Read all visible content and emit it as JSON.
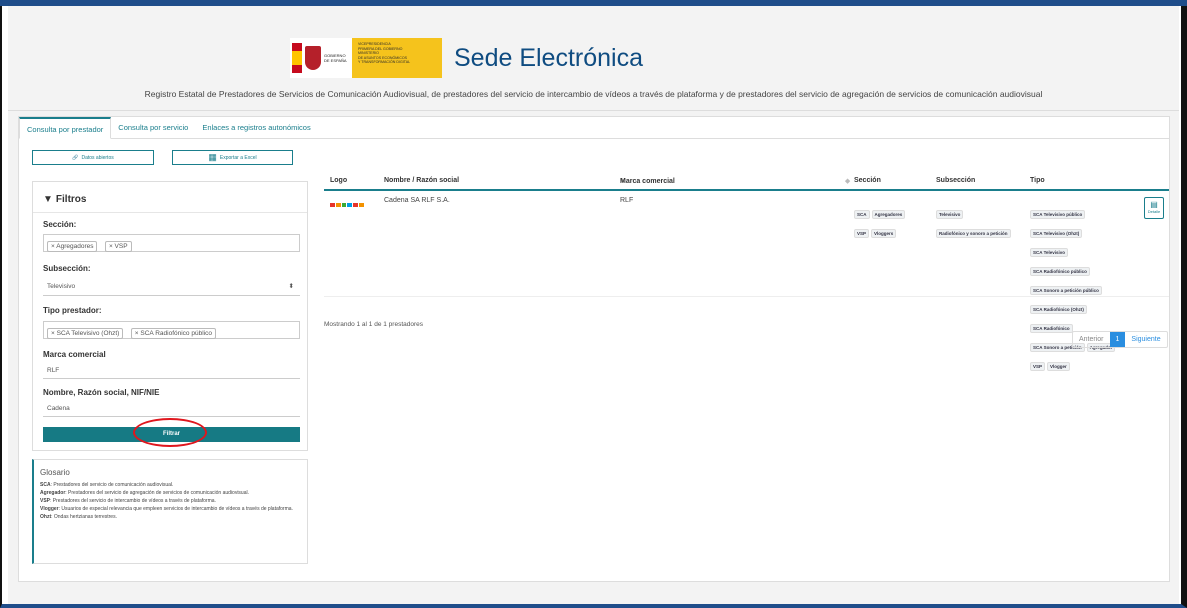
{
  "header": {
    "gov_line1": "GOBIERNO",
    "gov_line2": "DE ESPAÑA",
    "ministry_lines": [
      "VICEPRESIDENCIA",
      "PRIMERA DEL GOBIERNO",
      "MINISTERIO",
      "DE ASUNTOS ECONÓMICOS",
      "Y TRANSFORMACIÓN DIGITAL"
    ],
    "site_title": "Sede Electrónica",
    "subtitle": "Registro Estatal de Prestadores de Servicios de Comunicación Audiovisual, de prestadores del servicio de intercambio de vídeos a través de plataforma y de prestadores del servicio de agregación de servicios de comunicación audiovisual"
  },
  "tabs": [
    {
      "label": "Consulta por prestador"
    },
    {
      "label": "Consulta por servicio"
    },
    {
      "label": "Enlaces a registros autonómicos"
    }
  ],
  "actions": {
    "direct_data": "Datos abiertos",
    "export_excel": "Exportar a Excel"
  },
  "filters": {
    "title": "Filtros",
    "section_label": "Sección:",
    "section_tags": [
      "Agregadores",
      "VSP"
    ],
    "subsection_label": "Subsección:",
    "subsection_value": "Televisivo",
    "type_label": "Tipo prestador:",
    "type_tags": [
      "SCA Televisivo (Ohzt)",
      "SCA Radiofónico público"
    ],
    "brand_label": "Marca comercial",
    "brand_value": "RLF",
    "name_label": "Nombre, Razón social, NIF/NIE",
    "name_value": "Cadena",
    "filter_button": "Filtrar"
  },
  "glossary": {
    "title": "Glosario",
    "items": [
      {
        "term": "SCA",
        "text": ": Prestadores del servicio de comunicación audiovisual."
      },
      {
        "term": "Agregador",
        "text": ": Prestadores del servicio de agregación de servicios de comunicación audiovisual."
      },
      {
        "term": "VSP",
        "text": ": Prestadores del servicio de intercambio de vídeos a través de plataforma."
      },
      {
        "term": "Vlogger",
        "text": ": Usuarios de especial relevancia que empleen servicios de intercambio de vídeos a través de plataforma."
      },
      {
        "term": "Ohzt",
        "text": ": Ondas hertzianas terrestres."
      }
    ]
  },
  "table": {
    "headers": [
      "Logo",
      "Nombre / Razón social",
      "Marca comercial",
      "Sección",
      "Subsección",
      "Tipo"
    ],
    "row": {
      "name": "Cadena SA RLF S.A.",
      "brand": "RLF",
      "sections": [
        "SCA",
        "Agregadores",
        "VSP",
        "Vloggers"
      ],
      "subsections": [
        "Televisivo",
        "Radiofónico y sonoro a petición"
      ],
      "types": [
        "SCA Televisivo público",
        "SCA Televisivo (Ohzt)",
        "SCA Televisivo",
        "SCA Radiofónico público",
        "SCA Sonoro a petición público",
        "SCA Radiofónico (Ohzt)",
        "SCA Radiofónico",
        "SCA Sonoro a petición",
        "Agregador",
        "VSP",
        "Vlogger"
      ],
      "detail_label": "Detalle"
    }
  },
  "showing": "Mostrando 1 al 1 de 1 prestadores",
  "pagination": {
    "prev": "Anterior",
    "current": "1",
    "next": "Siguiente"
  },
  "colors": {
    "accent": "#1a7e8c",
    "brand_blue": "#0f4c81",
    "highlight": "#e0161d"
  }
}
